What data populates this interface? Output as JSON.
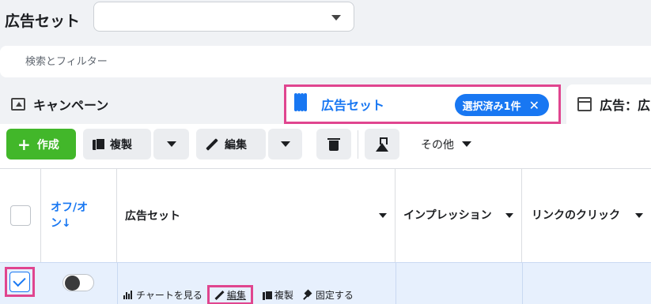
{
  "header": {
    "title": "広告セット",
    "selector_value": ""
  },
  "search": {
    "placeholder": "検索とフィルター"
  },
  "tabs": [
    {
      "label": "キャンペーン",
      "icon": "folder-icon"
    },
    {
      "label": "広告セット",
      "icon": "grid-icon",
      "selected_chip": "選択済み1件"
    },
    {
      "label": "広告：広",
      "icon": "ad-icon"
    }
  ],
  "toolbar": {
    "create_label": "作成",
    "duplicate_label": "複製",
    "edit_label": "編集",
    "more_label": "その他"
  },
  "table": {
    "columns": {
      "toggle": "オフ/オン↓",
      "name": "広告セット",
      "impressions": "インプレッション",
      "link_clicks": "リンクのクリック"
    },
    "row": {
      "selected": true,
      "toggle_on": false,
      "actions": {
        "chart": "チャートを見る",
        "edit": "編集",
        "duplicate": "複製",
        "pin": "固定する"
      }
    }
  },
  "colors": {
    "accent": "#1877f2",
    "create_green": "#42b72a",
    "highlight_pink": "#e0458f"
  }
}
